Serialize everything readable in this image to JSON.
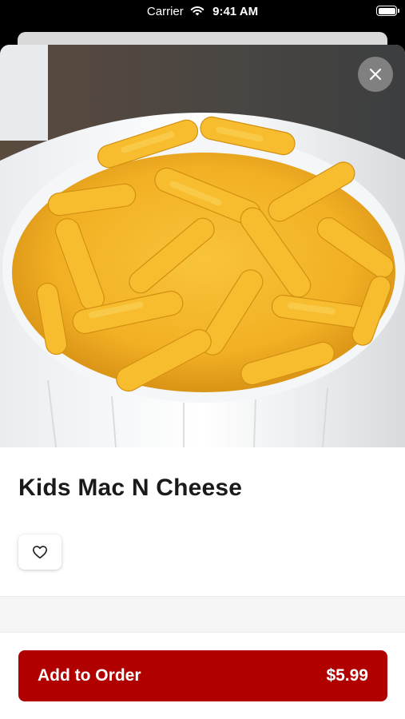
{
  "status_bar": {
    "carrier": "Carrier",
    "time": "9:41 AM",
    "wifi_icon": "wifi-icon",
    "battery_icon": "battery-full-icon"
  },
  "item": {
    "name": "Kids Mac N Cheese",
    "image": "macaroni-and-cheese-photo",
    "favorite_icon": "heart-outline-icon",
    "close_icon": "close-icon"
  },
  "order_button": {
    "label": "Add to Order",
    "price": "$5.99"
  },
  "colors": {
    "accent": "#b00000",
    "title": "#1a1a1a"
  }
}
